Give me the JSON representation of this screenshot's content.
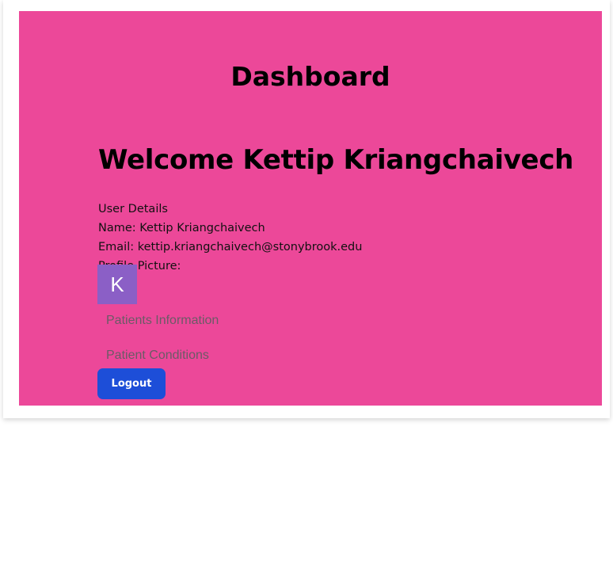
{
  "dashboard": {
    "title": "Dashboard"
  },
  "welcome": {
    "heading": "Welcome Kettip Kriangchaivech"
  },
  "user_details": {
    "header": "User Details",
    "name_line": "Name: Kettip Kriangchaivech",
    "email_line": "Email: kettip.kriangchaivech@stonybrook.edu",
    "picture_label": "Profile Picture:",
    "avatar_initial": "K"
  },
  "nav": {
    "patients_information": "Patients Information",
    "patient_conditions": "Patient Conditions"
  },
  "actions": {
    "logout_label": "Logout"
  },
  "colors": {
    "panel_background": "#ec4899",
    "avatar_background": "#8b5fc6",
    "logout_background": "#1d4ed8",
    "link_text": "#6b5b66"
  }
}
